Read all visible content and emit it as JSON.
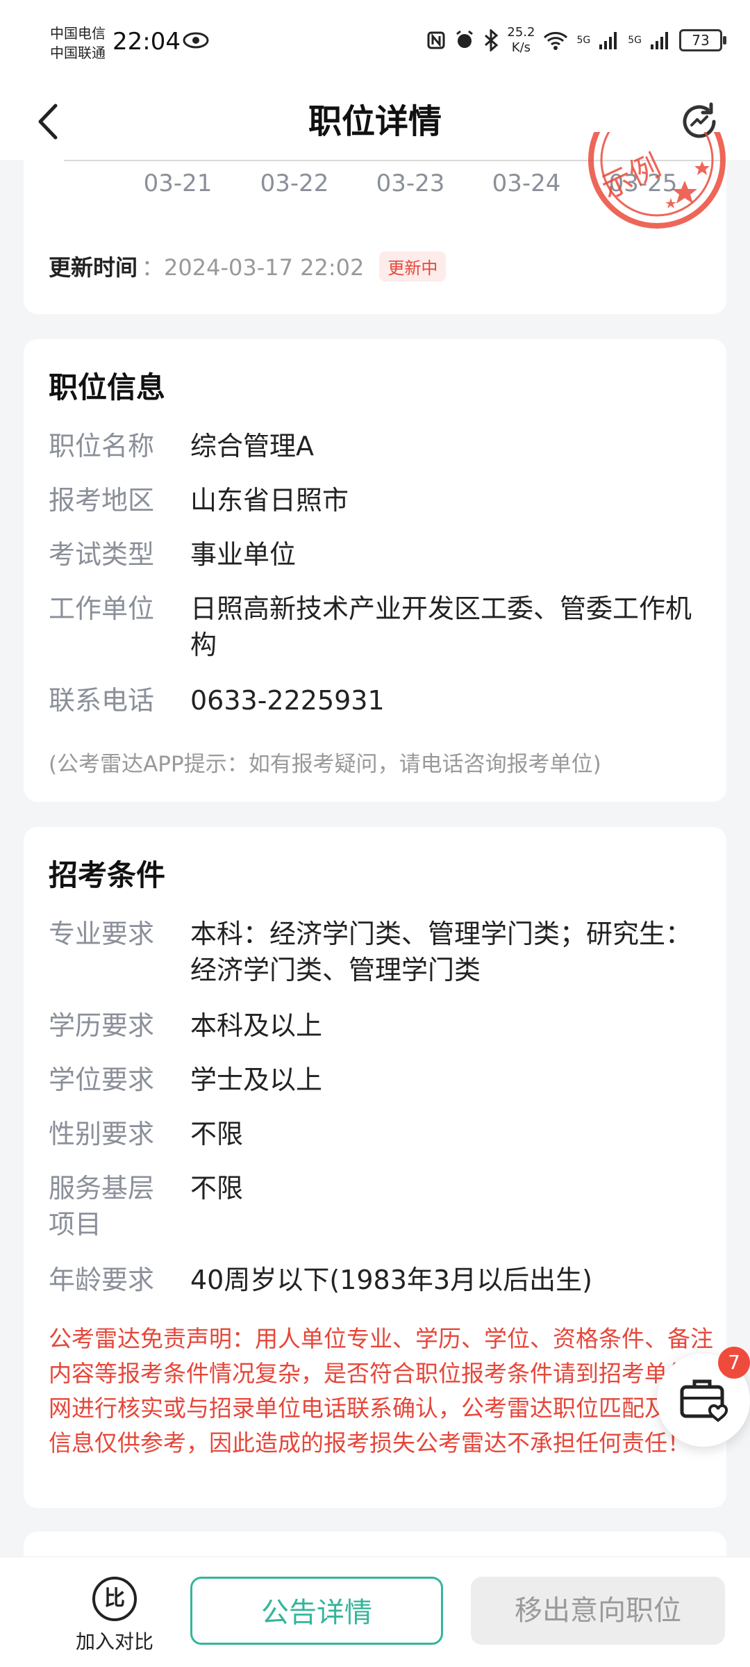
{
  "status_bar": {
    "carrier1": "中国电信",
    "carrier2": "中国联通",
    "time": "22:04",
    "net_speed_value": "25.2",
    "net_speed_unit": "K/s",
    "sig1": "5G",
    "sig2": "5G",
    "battery": "73"
  },
  "header": {
    "title": "职位详情"
  },
  "trend": {
    "dates": [
      "03-21",
      "03-22",
      "03-23",
      "03-24",
      "03-25"
    ],
    "update_label": "更新时间",
    "update_time": "2024-03-17 22:02",
    "update_badge": "更新中",
    "stamp_text": "示例"
  },
  "position_info": {
    "title": "职位信息",
    "rows": [
      {
        "label": "职位名称",
        "value": "综合管理A"
      },
      {
        "label": "报考地区",
        "value": "山东省日照市"
      },
      {
        "label": "考试类型",
        "value": "事业单位"
      },
      {
        "label": "工作单位",
        "value": "日照高新技术产业开发区工委、管委工作机构"
      },
      {
        "label": "联系电话",
        "value": "0633-2225931"
      }
    ],
    "note": "(公考雷达APP提示：如有报考疑问，请电话咨询报考单位)"
  },
  "requirements": {
    "title": "招考条件",
    "rows": [
      {
        "label": "专业要求",
        "value": "本科：经济学门类、管理学门类；研究生：经济学门类、管理学门类"
      },
      {
        "label": "学历要求",
        "value": "本科及以上"
      },
      {
        "label": "学位要求",
        "value": "学士及以上"
      },
      {
        "label": "性别要求",
        "value": "不限"
      },
      {
        "label": "服务基层项目",
        "value": "不限"
      },
      {
        "label": "年龄要求",
        "value": "40周岁以下(1983年3月以后出生)"
      }
    ],
    "disclaimer": "公考雷达免责声明：用人单位专业、学历、学位、资格条件、备注内容等报考条件情况复杂，是否符合职位报考条件请到招考单位官网进行核实或与招录单位电话联系确认，公考雷达职位匹配及相关信息仅供参考，因此造成的报考损失公考雷达不承担任何责任！"
  },
  "floating": {
    "badge_count": "7"
  },
  "bottom_bar": {
    "compare_icon_text": "比",
    "compare_label": "加入对比",
    "notice_button": "公告详情",
    "remove_button": "移出意向职位"
  },
  "colors": {
    "accent": "#34b59b",
    "warning": "#e5473a",
    "label_gray": "#8a8f99"
  }
}
